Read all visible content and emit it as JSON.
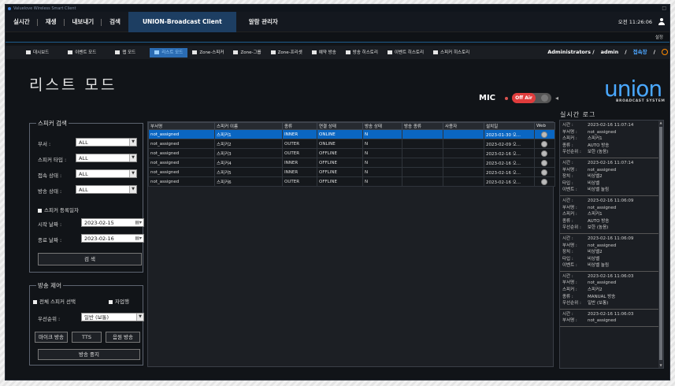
{
  "window": {
    "title": "Valuelove Wireless Smart Client"
  },
  "menu": {
    "items": [
      "실시간",
      "재생",
      "내보내기",
      "검색"
    ],
    "active": "UNION-Broadcast Client",
    "extra": "알람 관리자",
    "clock": "오전 11:26:06"
  },
  "subbar": {
    "settings": "설정"
  },
  "toolbar": {
    "buttons": [
      "대시보드",
      "이벤트 모드",
      "맵 모드",
      "리스트 모드",
      "Zone-스피커",
      "Zone-그룹",
      "Zone-프리셋",
      "예약 방송",
      "방송 히스토리",
      "이벤트 히스토리",
      "스피커 히스토리"
    ],
    "user": "Administrators /",
    "admin": "admin",
    "logout": "접속장",
    "slash": "/"
  },
  "page": {
    "title": "리스트 모드",
    "mic_label": "MIC",
    "onair": "Off Air",
    "logo_word": "union",
    "logo_sub": "BROADCAST SYSTEM"
  },
  "search": {
    "legend": "스피커 검색",
    "dept_label": "부서 :",
    "dept_value": "ALL",
    "type_label": "스피커 타입 :",
    "type_value": "ALL",
    "conn_label": "접속 상태 :",
    "conn_value": "ALL",
    "bcast_label": "방송 상태 :",
    "bcast_value": "ALL",
    "registrant_label": "스피커 등록일자",
    "start_label": "시작 날짜 :",
    "start_value": "2023-02-15",
    "end_label": "종료 날짜 :",
    "end_value": "2023-02-16",
    "search_btn": "검 색"
  },
  "control": {
    "legend": "방송 제어",
    "select_all": "전체 스피커 선택",
    "auto": "자업행",
    "priority_label": "우선순위 :",
    "priority_value": "일반 (보통)",
    "mic_btn": "마이크 방송",
    "tts_btn": "TTS",
    "source_btn": "음원 방송",
    "stop_btn": "방송 중지"
  },
  "table": {
    "headers": [
      "부서명",
      "스피커 이름",
      "종류",
      "연결 상태",
      "방송 상태",
      "방송 종류",
      "사용자",
      "설치일",
      "Web"
    ],
    "rows": [
      [
        "not_assigned",
        "스피커1",
        "INNER",
        "ONLINE",
        "N",
        "",
        "",
        "2023-01-30 오..."
      ],
      [
        "not_assigned",
        "스피커2",
        "OUTER",
        "ONLINE",
        "N",
        "",
        "",
        "2023-02-09 오..."
      ],
      [
        "not_assigned",
        "스피커3",
        "OUTER",
        "OFFLINE",
        "N",
        "",
        "",
        "2023-02-16 오..."
      ],
      [
        "not_assigned",
        "스피커4",
        "INNER",
        "OFFLINE",
        "N",
        "",
        "",
        "2023-02-16 오..."
      ],
      [
        "not_assigned",
        "스피커5",
        "INNER",
        "OFFLINE",
        "N",
        "",
        "",
        "2023-02-16 오..."
      ],
      [
        "not_assigned",
        "스피커6",
        "OUTER",
        "OFFLINE",
        "N",
        "",
        "",
        "2023-02-16 오..."
      ]
    ]
  },
  "log": {
    "title": "실시간 로그",
    "entries": [
      [
        [
          "시간 :",
          "2023-02-16 11:07:14"
        ],
        [
          "부서명 :",
          "not_assigned"
        ],
        [
          "스피커 :",
          "스피커1"
        ],
        [
          "종류 :",
          "AUTO 방송"
        ],
        [
          "우선순위 :",
          "보한 (높음)"
        ]
      ],
      [
        [
          "시간 :",
          "2023-02-16 11:07:14"
        ],
        [
          "부서명 :",
          "not_assigned"
        ],
        [
          "장치 :",
          "비상벨2"
        ],
        [
          "타입 :",
          "비상벨"
        ],
        [
          "이벤트 :",
          "비상벨 눌림"
        ]
      ],
      [
        [
          "시간 :",
          "2023-02-16 11:06:09"
        ],
        [
          "부서명 :",
          "not_assigned"
        ],
        [
          "스피커 :",
          "스피커1"
        ],
        [
          "종류 :",
          "AUTO 방송"
        ],
        [
          "우선순위 :",
          "보한 (높음)"
        ]
      ],
      [
        [
          "시간 :",
          "2023-02-16 11:06:09"
        ],
        [
          "부서명 :",
          "not_assigned"
        ],
        [
          "장치 :",
          "비상벨2"
        ],
        [
          "타입 :",
          "비상벨"
        ],
        [
          "이벤트 :",
          "비상벨 눌림"
        ]
      ],
      [
        [
          "시간 :",
          "2023-02-16 11:06:03"
        ],
        [
          "부서명 :",
          "not_assigned"
        ],
        [
          "스피커 :",
          "스피커2"
        ],
        [
          "종류 :",
          "MANUAL 방송"
        ],
        [
          "우선순위 :",
          "일반 (보통)"
        ]
      ],
      [
        [
          "시간 :",
          "2023-02-16 11:06:03"
        ],
        [
          "부서명 :",
          "not_assigned"
        ]
      ]
    ]
  },
  "colors": {
    "accent": "#2b6cb3",
    "selected_row": "#0a66c2",
    "onair": "#e03c3c",
    "logo": "#4aa8ff"
  }
}
